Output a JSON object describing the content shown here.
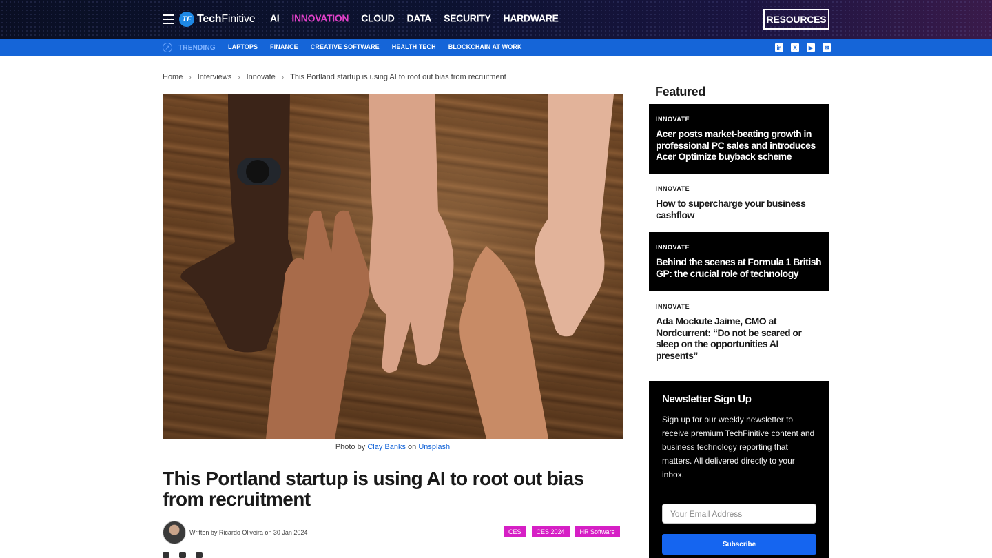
{
  "header": {
    "logo_text_bold": "Tech",
    "logo_text_rest": "Finitive",
    "nav": [
      "AI",
      "INNOVATION",
      "CLOUD",
      "DATA",
      "SECURITY",
      "HARDWARE"
    ],
    "active_nav": "INNOVATION",
    "resources_label": "RESOURCES"
  },
  "trending": {
    "label": "TRENDING",
    "links": [
      "LAPTOPS",
      "FINANCE",
      "CREATIVE SOFTWARE",
      "HEALTH TECH",
      "BLOCKCHAIN AT WORK"
    ],
    "socials": [
      "linkedin-icon",
      "x-icon",
      "youtube-icon",
      "mail-icon"
    ]
  },
  "breadcrumb": [
    "Home",
    "Interviews",
    "Innovate",
    "This Portland startup is using AI to root out bias from recruitment"
  ],
  "hero": {
    "caption_prefix": "Photo by ",
    "caption_author": "Clay Banks",
    "caption_mid": " on ",
    "caption_site": "Unsplash"
  },
  "article": {
    "title": "This Portland startup is using AI to root out bias from recruitment",
    "byline": "Written by Ricardo Oliveira on 30 Jan 2024",
    "tags": [
      "CES",
      "CES 2024",
      "HR Software"
    ]
  },
  "featured": {
    "heading": "Featured",
    "items": [
      {
        "category": "INNOVATE",
        "title": "Acer posts market-beating growth in professional PC sales and introduces Acer Optimize buyback scheme",
        "dark": true
      },
      {
        "category": "INNOVATE",
        "title": "How to supercharge your business cashflow",
        "dark": false
      },
      {
        "category": "INNOVATE",
        "title": "Behind the scenes at Formula 1 British GP: the crucial role of technology",
        "dark": true
      },
      {
        "category": "INNOVATE",
        "title": "Ada Mockute Jaime, CMO at Nordcurrent: “Do not be scared or sleep on the opportunities AI presents”",
        "dark": false
      }
    ]
  },
  "newsletter": {
    "heading": "Newsletter Sign Up",
    "body": "Sign up for our weekly newsletter to receive premium TechFinitive content and business technology reporting that matters. All delivered directly to your inbox.",
    "email_placeholder": "Your Email Address",
    "subscribe_label": "Subscribe"
  },
  "colors": {
    "accent_magenta": "#d61fc5",
    "brand_blue": "#1565d8",
    "header_dark": "#0a0f24"
  }
}
